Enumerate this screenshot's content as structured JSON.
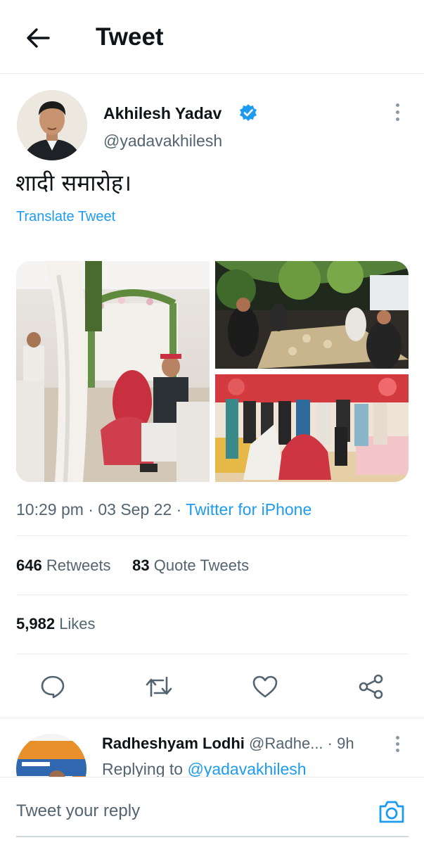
{
  "header": {
    "title": "Tweet",
    "back_icon": "arrow-left-icon"
  },
  "author": {
    "name": "Akhilesh Yadav",
    "handle": "@yadavakhilesh",
    "verified": true,
    "verified_color": "#1d9bf0"
  },
  "tweet": {
    "text": "शादी समारोह।",
    "translate_label": "Translate Tweet",
    "time": "10:29 pm",
    "date": "03 Sep 22",
    "source": "Twitter for iPhone",
    "images": [
      "wedding-ceremony-photo",
      "dinner-gathering-photo",
      "stage-group-photo"
    ]
  },
  "stats": {
    "retweets_count": "646",
    "retweets_label": "Retweets",
    "quotes_count": "83",
    "quotes_label": "Quote Tweets",
    "likes_count": "5,982",
    "likes_label": "Likes"
  },
  "actions": [
    "reply-icon",
    "retweet-icon",
    "like-icon",
    "share-icon"
  ],
  "reply": {
    "name": "Radheshyam Lodhi",
    "handle": "@Radhe...",
    "time": "9h",
    "replying_prefix": "Replying to",
    "replying_to": "@yadavakhilesh"
  },
  "composer": {
    "placeholder": "Tweet your reply",
    "camera_icon": "camera-icon"
  },
  "colors": {
    "accent": "#1d9bf0",
    "text": "#0f1419",
    "secondary": "#536471",
    "border": "#e6ecf0"
  }
}
